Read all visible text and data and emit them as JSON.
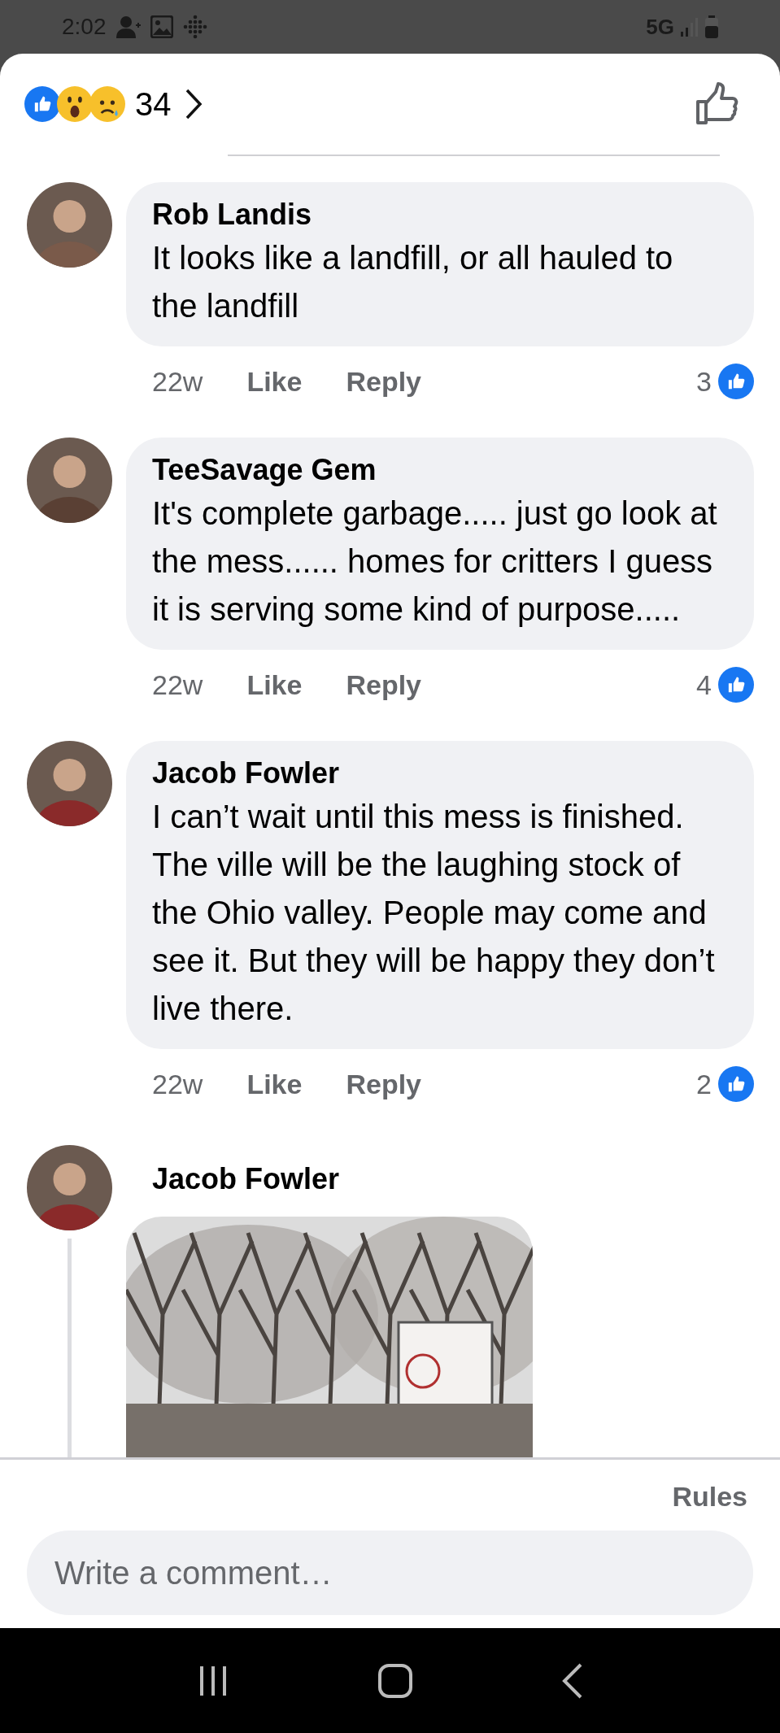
{
  "status_bar": {
    "time": "2:02",
    "network": "5G"
  },
  "reactions": {
    "count": "34"
  },
  "comments": [
    {
      "kind": "text",
      "author": "Rob Landis",
      "text": "It looks like a landfill, or all hauled to the landfill",
      "time": "22w",
      "actions": [
        "Like",
        "Reply"
      ],
      "likes": "3"
    },
    {
      "kind": "text",
      "author": "TeeSavage Gem",
      "text": "It's complete garbage.....  just go look at the mess...... homes for critters I guess it is serving some kind of purpose.....",
      "time": "22w",
      "actions": [
        "Like",
        "Reply"
      ],
      "likes": "4"
    },
    {
      "kind": "text",
      "author": "Jacob Fowler",
      "text": "I can’t wait until this mess is finished. The ville will be the laughing stock of the Ohio valley. People may come and see it. But they will be happy they don’t live there.",
      "time": "22w",
      "actions": [
        "Like",
        "Reply"
      ],
      "likes": "2"
    },
    {
      "author": "Jacob Fowler"
    }
  ],
  "footer": {
    "rules": "Rules"
  },
  "composer": {
    "placeholder": "Write a comment…"
  }
}
